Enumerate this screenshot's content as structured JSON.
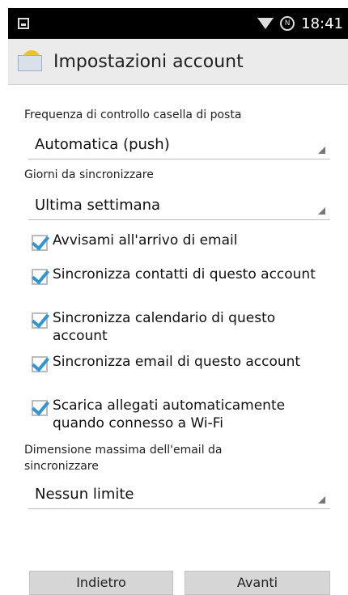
{
  "status_bar": {
    "time": "18:41",
    "battery_badge": "N"
  },
  "action_bar": {
    "title": "Impostazioni account"
  },
  "settings": {
    "check_frequency_label": "Frequenza di controllo casella di posta",
    "check_frequency_value": "Automatica (push)",
    "sync_days_label": "Giorni da sincronizzare",
    "sync_days_value": "Ultima settimana",
    "checkboxes": [
      {
        "label": "Avvisami all'arrivo di email",
        "checked": true
      },
      {
        "label": "Sincronizza contatti di questo account",
        "checked": true
      },
      {
        "label": "Sincronizza calendario di questo account",
        "checked": true
      },
      {
        "label": "Sincronizza email di questo account",
        "checked": true
      },
      {
        "label": "Scarica allegati automaticamente quando connesso a Wi-Fi",
        "checked": true
      }
    ],
    "max_size_label": "Dimensione massima dell'email da sincronizzare",
    "max_size_value": "Nessun limite"
  },
  "buttons": {
    "back": "Indietro",
    "next": "Avanti"
  },
  "colors": {
    "accent": "#2f95d6",
    "actionbar": "#ebebeb"
  }
}
